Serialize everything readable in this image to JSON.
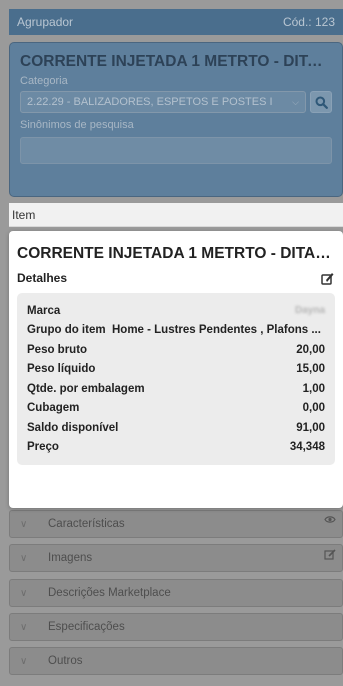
{
  "group": {
    "header_label": "Agrupador",
    "code_label": "Cód.: 123",
    "title": "CORRENTE INJETADA 1 METRTO - DITAL - ...",
    "category_label": "Categoria",
    "category_value": "2.22.29 - BALIZADORES, ESPETOS E POSTES I",
    "synonyms_label": "Sinônimos de pesquisa",
    "synonyms_value": ""
  },
  "modal": {
    "header_label": "Item",
    "item_title": "CORRENTE INJETADA 1 METRTO - DITAL - ...",
    "details_label": "Detalhes",
    "details": [
      {
        "label": "Marca",
        "value": "Dayna"
      },
      {
        "label": "Grupo do item",
        "value": "Home - Lustres Pendentes , Plafons ..."
      },
      {
        "label": "Peso bruto",
        "value": "20,00"
      },
      {
        "label": "Peso líquido",
        "value": "15,00"
      },
      {
        "label": "Qtde. por embalagem",
        "value": "1,00"
      },
      {
        "label": "Cubagem",
        "value": "0,00"
      },
      {
        "label": "Saldo disponível",
        "value": "91,00"
      },
      {
        "label": "Preço",
        "value": "34,348"
      }
    ]
  },
  "sections": [
    {
      "label": "Características",
      "icon": "eye-icon"
    },
    {
      "label": "Imagens",
      "icon": "edit-icon"
    },
    {
      "label": "Descrições Marketplace",
      "icon": ""
    },
    {
      "label": "Especificações",
      "icon": ""
    },
    {
      "label": "Outros",
      "icon": ""
    }
  ],
  "colors": {
    "header_bg": "#4a6e8d",
    "panel_bg": "#5e7f9c",
    "modal_bg": "#ffffff",
    "details_bg": "#ececec"
  }
}
